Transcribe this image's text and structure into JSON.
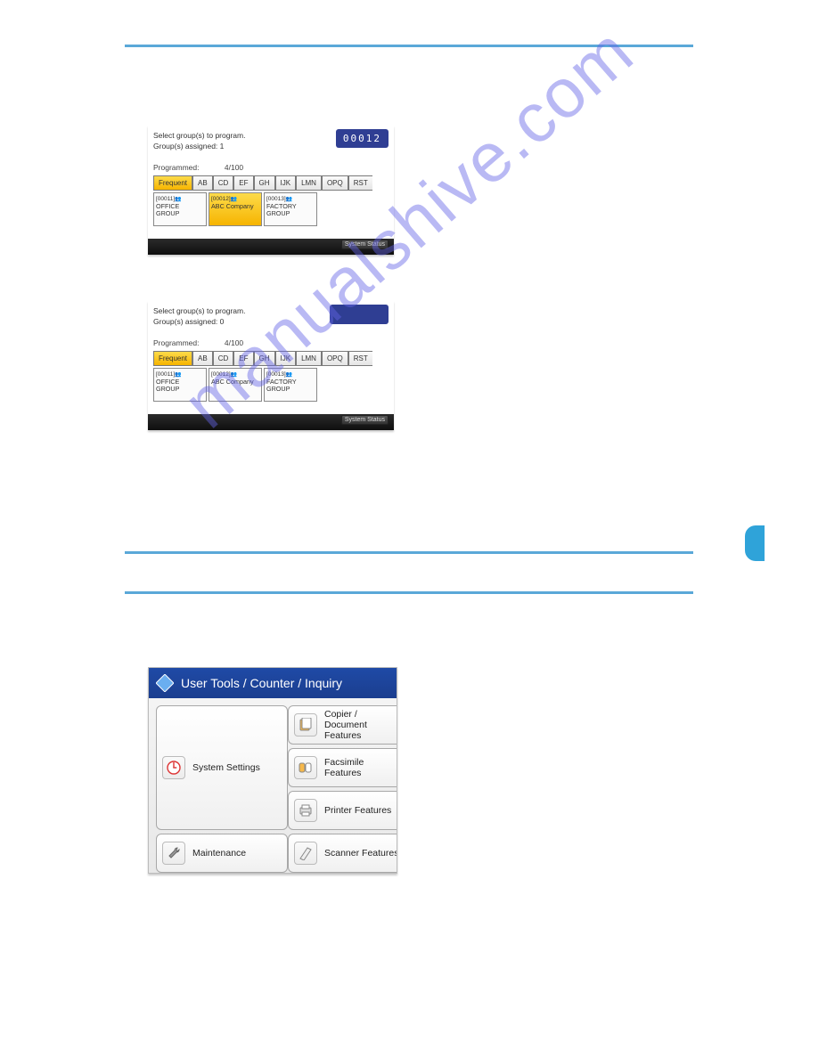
{
  "watermark": "manualshive.com",
  "panel1": {
    "select_text": "Select group(s) to program.",
    "assigned_label": "Group(s) assigned:",
    "assigned_value": "1",
    "counter": "00012",
    "programmed_label": "Programmed:",
    "programmed_value": "4/100",
    "tabs": [
      "Frequent",
      "AB",
      "CD",
      "EF",
      "GH",
      "IJK",
      "LMN",
      "OPQ",
      "RST"
    ],
    "cards": [
      {
        "id": "[00011]",
        "icons": "👥",
        "label": "OFFICE GROUP",
        "selected": false
      },
      {
        "id": "[00012]",
        "icons": "👥",
        "label": "ABC Company",
        "selected": true
      },
      {
        "id": "[00013]",
        "icons": "👥",
        "label": "FACTORY GROUP",
        "selected": false
      }
    ],
    "sysbtn": "System Status"
  },
  "panel2": {
    "select_text": "Select group(s) to program.",
    "assigned_label": "Group(s) assigned:",
    "assigned_value": "0",
    "programmed_label": "Programmed:",
    "programmed_value": "4/100",
    "tabs": [
      "Frequent",
      "AB",
      "CD",
      "EF",
      "GH",
      "IJK",
      "LMN",
      "OPQ",
      "RST"
    ],
    "cards": [
      {
        "id": "[00011]",
        "icons": "👥",
        "label": "OFFICE GROUP",
        "selected": false
      },
      {
        "id": "[00012]",
        "icons": "👥",
        "label": "ABC Company",
        "selected": false
      },
      {
        "id": "[00013]",
        "icons": "👥",
        "label": "FACTORY GROUP",
        "selected": false
      }
    ],
    "sysbtn": "System Status"
  },
  "bluepanel": {
    "title": "User Tools / Counter / Inquiry",
    "system_settings": "System Settings",
    "items": [
      "Copier / Document Features",
      "Facsimile Features",
      "Printer Features",
      "Scanner Features"
    ],
    "maintenance": "Maintenance"
  }
}
